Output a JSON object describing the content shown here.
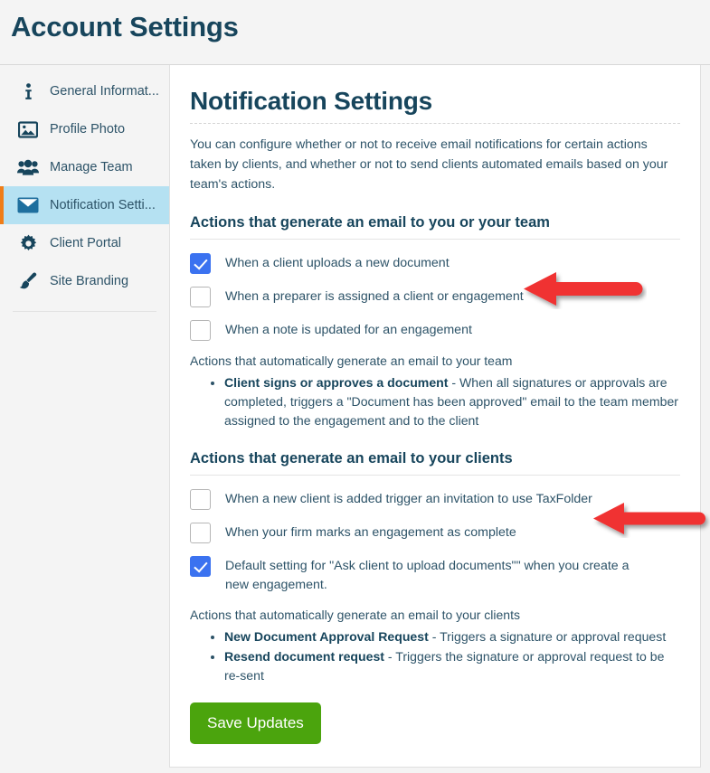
{
  "app": {
    "title": "Account Settings"
  },
  "sidebar": {
    "items": [
      {
        "label": "General Informat...",
        "icon": "info-icon",
        "active": false
      },
      {
        "label": "Profile Photo",
        "icon": "image-icon",
        "active": false
      },
      {
        "label": "Manage Team",
        "icon": "users-icon",
        "active": false
      },
      {
        "label": "Notification Setti...",
        "icon": "envelope-icon",
        "active": true
      },
      {
        "label": "Client Portal",
        "icon": "gear-icon",
        "active": false
      },
      {
        "label": "Site Branding",
        "icon": "paintbrush-icon",
        "active": false
      }
    ]
  },
  "main": {
    "title": "Notification Settings",
    "intro": "You can configure whether or not to receive email notifications for certain actions taken by clients, and whether or not to send clients automated emails based on your team's actions.",
    "sections": [
      {
        "heading": "Actions that generate an email to you or your team",
        "checkboxes": [
          {
            "label": "When a client uploads a new document",
            "checked": true
          },
          {
            "label": "When a preparer is assigned a client or engagement",
            "checked": false
          },
          {
            "label": "When a note is updated for an engagement",
            "checked": false
          }
        ],
        "sub_note": "Actions that automatically generate an email to your team",
        "bullets": [
          {
            "bold": "Client signs or approves a document",
            "rest": " - When all signatures or approvals are completed, triggers a \"Document has been approved\" email to the team member assigned to the engagement and to the client"
          }
        ]
      },
      {
        "heading": "Actions that generate an email to your clients",
        "checkboxes": [
          {
            "label": "When a new client is added trigger an invitation to use TaxFolder",
            "checked": false
          },
          {
            "label": "When your firm marks an engagement as complete",
            "checked": false
          },
          {
            "label": "Default setting for \"Ask client to upload documents\"\" when you create a new engagement.",
            "checked": true
          }
        ],
        "sub_note": "Actions that automatically generate an email to your clients",
        "bullets": [
          {
            "bold": "New Document Approval Request",
            "rest": " - Triggers a signature or approval request"
          },
          {
            "bold": "Resend document request",
            "rest": " - Triggers the signature or approval request to be re-sent"
          }
        ]
      }
    ],
    "save_label": "Save Updates"
  },
  "annotations": {
    "arrows": [
      {
        "name": "arrow-pointing-preparer-checkbox",
        "color": "#f03030"
      },
      {
        "name": "arrow-pointing-new-client-checkbox",
        "color": "#f03030"
      }
    ]
  },
  "colors": {
    "accent_navy": "#17455c",
    "active_nav_bg": "#b5e1f2",
    "active_nav_marker": "#f07d18",
    "checkbox_checked": "#3b72f0",
    "save_button": "#4ba40d",
    "arrow_red": "#f03030"
  }
}
